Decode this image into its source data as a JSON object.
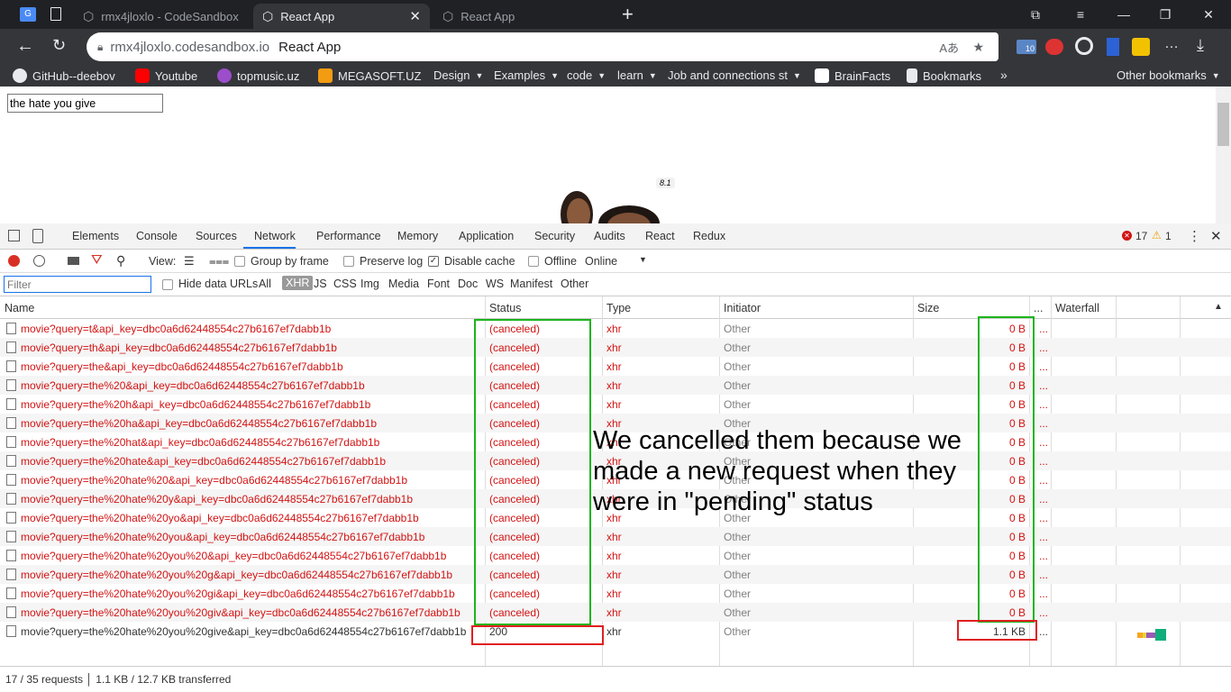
{
  "browser": {
    "tabs": [
      {
        "label": "rmx4jloxlo - CodeSandbox"
      },
      {
        "label": "React App",
        "active": true
      },
      {
        "label": "React App"
      }
    ],
    "url_host": "rmx4jloxlo.codesandbox.io",
    "url_title": "React App",
    "bookmarks": [
      "GitHub--deebov",
      "Youtube",
      "topmusic.uz",
      "MEGASOFT.UZ",
      "Design",
      "Examples",
      "code",
      "learn",
      "Job and connections st",
      "BrainFacts",
      "Bookmarks",
      "Other bookmarks"
    ],
    "ext_badge": "10"
  },
  "page": {
    "search_value": "the hate you give",
    "rating": "8.1"
  },
  "devtools": {
    "tabs": [
      "Elements",
      "Console",
      "Sources",
      "Network",
      "Performance",
      "Memory",
      "Application",
      "Security",
      "Audits",
      "React",
      "Redux"
    ],
    "active_tab": "Network",
    "errors": "17",
    "warnings": "1",
    "toolbar": {
      "view_label": "View:",
      "group_by_frame": "Group by frame",
      "preserve_log": "Preserve log",
      "disable_cache": "Disable cache",
      "offline": "Offline",
      "online": "Online"
    },
    "filter_placeholder": "Filter",
    "hide_data_urls": "Hide data URLs",
    "types": [
      "All",
      "XHR",
      "JS",
      "CSS",
      "Img",
      "Media",
      "Font",
      "Doc",
      "WS",
      "Manifest",
      "Other"
    ],
    "columns": {
      "name": "Name",
      "status": "Status",
      "type": "Type",
      "initiator": "Initiator",
      "size": "Size",
      "more": "...",
      "waterfall": "Waterfall"
    },
    "requests": [
      {
        "name": "movie?query=t&api_key=dbc0a6d62448554c27b6167ef7dabb1b",
        "status": "(canceled)",
        "type": "xhr",
        "initiator": "Other",
        "size": "0 B"
      },
      {
        "name": "movie?query=th&api_key=dbc0a6d62448554c27b6167ef7dabb1b",
        "status": "(canceled)",
        "type": "xhr",
        "initiator": "Other",
        "size": "0 B"
      },
      {
        "name": "movie?query=the&api_key=dbc0a6d62448554c27b6167ef7dabb1b",
        "status": "(canceled)",
        "type": "xhr",
        "initiator": "Other",
        "size": "0 B"
      },
      {
        "name": "movie?query=the%20&api_key=dbc0a6d62448554c27b6167ef7dabb1b",
        "status": "(canceled)",
        "type": "xhr",
        "initiator": "Other",
        "size": "0 B"
      },
      {
        "name": "movie?query=the%20h&api_key=dbc0a6d62448554c27b6167ef7dabb1b",
        "status": "(canceled)",
        "type": "xhr",
        "initiator": "Other",
        "size": "0 B"
      },
      {
        "name": "movie?query=the%20ha&api_key=dbc0a6d62448554c27b6167ef7dabb1b",
        "status": "(canceled)",
        "type": "xhr",
        "initiator": "Other",
        "size": "0 B"
      },
      {
        "name": "movie?query=the%20hat&api_key=dbc0a6d62448554c27b6167ef7dabb1b",
        "status": "(canceled)",
        "type": "xhr",
        "initiator": "Other",
        "size": "0 B"
      },
      {
        "name": "movie?query=the%20hate&api_key=dbc0a6d62448554c27b6167ef7dabb1b",
        "status": "(canceled)",
        "type": "xhr",
        "initiator": "Other",
        "size": "0 B"
      },
      {
        "name": "movie?query=the%20hate%20&api_key=dbc0a6d62448554c27b6167ef7dabb1b",
        "status": "(canceled)",
        "type": "xhr",
        "initiator": "Other",
        "size": "0 B"
      },
      {
        "name": "movie?query=the%20hate%20y&api_key=dbc0a6d62448554c27b6167ef7dabb1b",
        "status": "(canceled)",
        "type": "xhr",
        "initiator": "Other",
        "size": "0 B"
      },
      {
        "name": "movie?query=the%20hate%20yo&api_key=dbc0a6d62448554c27b6167ef7dabb1b",
        "status": "(canceled)",
        "type": "xhr",
        "initiator": "Other",
        "size": "0 B"
      },
      {
        "name": "movie?query=the%20hate%20you&api_key=dbc0a6d62448554c27b6167ef7dabb1b",
        "status": "(canceled)",
        "type": "xhr",
        "initiator": "Other",
        "size": "0 B"
      },
      {
        "name": "movie?query=the%20hate%20you%20&api_key=dbc0a6d62448554c27b6167ef7dabb1b",
        "status": "(canceled)",
        "type": "xhr",
        "initiator": "Other",
        "size": "0 B"
      },
      {
        "name": "movie?query=the%20hate%20you%20g&api_key=dbc0a6d62448554c27b6167ef7dabb1b",
        "status": "(canceled)",
        "type": "xhr",
        "initiator": "Other",
        "size": "0 B"
      },
      {
        "name": "movie?query=the%20hate%20you%20gi&api_key=dbc0a6d62448554c27b6167ef7dabb1b",
        "status": "(canceled)",
        "type": "xhr",
        "initiator": "Other",
        "size": "0 B"
      },
      {
        "name": "movie?query=the%20hate%20you%20giv&api_key=dbc0a6d62448554c27b6167ef7dabb1b",
        "status": "(canceled)",
        "type": "xhr",
        "initiator": "Other",
        "size": "0 B"
      },
      {
        "name": "movie?query=the%20hate%20you%20give&api_key=dbc0a6d62448554c27b6167ef7dabb1b",
        "status": "200",
        "type": "xhr",
        "initiator": "Other",
        "size": "1.1 KB"
      }
    ],
    "summary": "17 / 35 requests  │  1.1 KB / 12.7 KB transferred"
  },
  "annotation": {
    "line1": "We cancelled them because we",
    "line2": "made a new request when they",
    "line3": "were in \"pending\" status"
  },
  "colors": {
    "error_red": "#d31313",
    "highlight_green": "#1db41d",
    "highlight_red": "#e02020"
  }
}
